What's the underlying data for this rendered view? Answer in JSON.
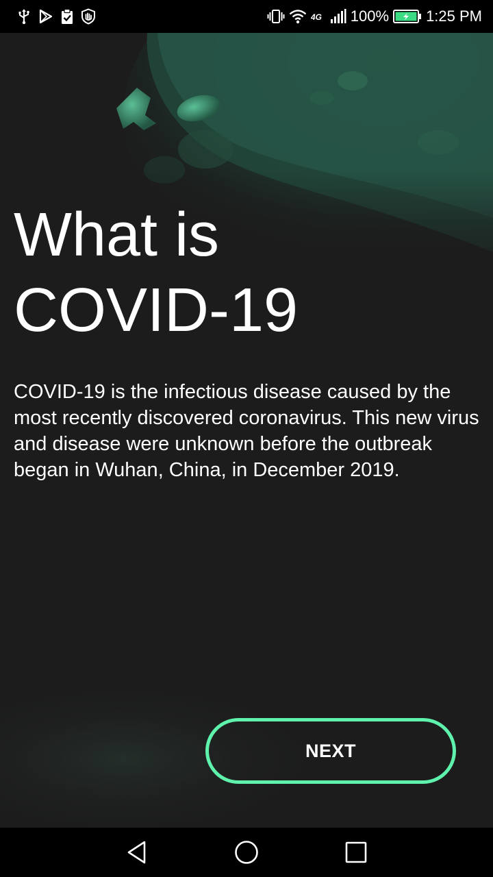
{
  "status_bar": {
    "left_icons": [
      "usb-icon",
      "play-store-icon",
      "clipboard-check-icon",
      "shield-hand-icon"
    ],
    "right_icons": [
      "vibrate-icon",
      "wifi-icon",
      "4g-icon",
      "signal-icon"
    ],
    "network_label": "4G",
    "battery_percent": "100%",
    "battery_level": 1.0,
    "battery_color": "#3ddc84",
    "time": "1:25 PM"
  },
  "onboarding": {
    "title_line1": "What is",
    "title_line2": "COVID-19",
    "description": "COVID-19 is the infectious disease caused by the most recently discovered coronavirus. This new virus and disease were unknown before the outbreak began in Wuhan, China, in December 2019.",
    "next_label": "NEXT",
    "accent_color": "#5ef2ac",
    "background_image": "coronavirus-image"
  },
  "nav_bar": {
    "buttons": [
      "back-icon",
      "home-icon",
      "recents-icon"
    ]
  }
}
